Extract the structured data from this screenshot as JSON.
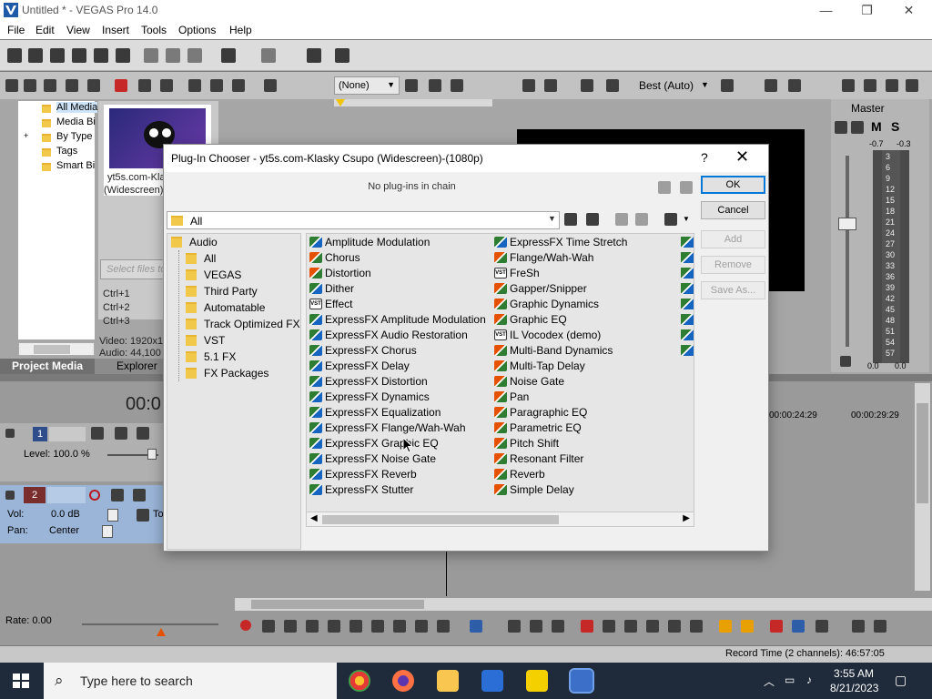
{
  "window": {
    "title": "Untitled * - VEGAS Pro 14.0",
    "minimize": "—",
    "maximize": "❐",
    "close": "✕"
  },
  "menu": [
    "File",
    "Edit",
    "View",
    "Insert",
    "Tools",
    "Options",
    "Help"
  ],
  "explorer": {
    "tree": [
      "All Media",
      "Media Bi",
      "By Type",
      "Tags",
      "Smart Bi"
    ],
    "media_name": "yt5s.com-Kla",
    "media_name2": "(Widescreen)",
    "search_placeholder": "Select files to",
    "shortcuts": [
      "Ctrl+1",
      "Ctrl+2",
      "Ctrl+3"
    ],
    "video_info": "Video: 1920x1",
    "audio_info": "Audio: 44,100",
    "tabs": [
      "Project Media",
      "Explorer"
    ]
  },
  "preview": {
    "preset": "(None)",
    "quality": "Best (Auto)"
  },
  "mixer": {
    "label": "Master",
    "m": "M",
    "s": "S",
    "peak_l": "-0.7",
    "peak_r": "-0.3",
    "scale": [
      "3",
      "6",
      "9",
      "12",
      "15",
      "18",
      "21",
      "24",
      "27",
      "30",
      "33",
      "36",
      "39",
      "42",
      "45",
      "48",
      "51",
      "54",
      "57"
    ],
    "bottom_l": "0.0",
    "bottom_r": "0.0"
  },
  "timeline": {
    "time_display": "00:0",
    "track1": {
      "number": "1",
      "level": "Level: 100.0 %"
    },
    "track2": {
      "number": "2",
      "vol_label": "Vol:",
      "vol_value": "0.0 dB",
      "pan_label": "Pan:",
      "pan_value": "Center",
      "extra": "To"
    },
    "ruler": [
      "00:00:24:29",
      "00:00:29:29"
    ],
    "rate": "Rate: 0.00",
    "record_time": "Record Time (2 channels): 46:57:05"
  },
  "dialog": {
    "title": "Plug-In Chooser - yt5s.com-Klasky Csupo (Widescreen)-(1080p)",
    "help": "?",
    "close": "✕",
    "chain_text": "No plug-ins in chain",
    "path": "All",
    "buttons": {
      "ok": "OK",
      "cancel": "Cancel",
      "add": "Add",
      "remove": "Remove",
      "save_as": "Save As..."
    },
    "folders": [
      {
        "label": "Audio",
        "level": 0
      },
      {
        "label": "All",
        "level": 1
      },
      {
        "label": "VEGAS",
        "level": 1
      },
      {
        "label": "Third Party",
        "level": 1
      },
      {
        "label": "Automatable",
        "level": 1
      },
      {
        "label": "Track Optimized FX",
        "level": 1
      },
      {
        "label": "VST",
        "level": 1
      },
      {
        "label": "5.1 FX",
        "level": 1
      },
      {
        "label": "FX Packages",
        "level": 1
      }
    ],
    "plugins_col1": [
      {
        "name": "Amplitude Modulation",
        "icon": "fx"
      },
      {
        "name": "Chorus",
        "icon": "orange"
      },
      {
        "name": "Distortion",
        "icon": "orange"
      },
      {
        "name": "Dither",
        "icon": "fx"
      },
      {
        "name": "Effect",
        "icon": "vst"
      },
      {
        "name": "ExpressFX Amplitude Modulation",
        "icon": "fx"
      },
      {
        "name": "ExpressFX Audio Restoration",
        "icon": "fx"
      },
      {
        "name": "ExpressFX Chorus",
        "icon": "fx"
      },
      {
        "name": "ExpressFX Delay",
        "icon": "fx"
      },
      {
        "name": "ExpressFX Distortion",
        "icon": "fx"
      },
      {
        "name": "ExpressFX Dynamics",
        "icon": "fx"
      },
      {
        "name": "ExpressFX Equalization",
        "icon": "fx"
      },
      {
        "name": "ExpressFX Flange/Wah-Wah",
        "icon": "fx"
      },
      {
        "name": "ExpressFX Graphic EQ",
        "icon": "fx"
      },
      {
        "name": "ExpressFX Noise Gate",
        "icon": "fx"
      },
      {
        "name": "ExpressFX Reverb",
        "icon": "fx"
      },
      {
        "name": "ExpressFX Stutter",
        "icon": "fx"
      }
    ],
    "plugins_col2": [
      {
        "name": "ExpressFX Time Stretch",
        "icon": "fx"
      },
      {
        "name": "Flange/Wah-Wah",
        "icon": "orange"
      },
      {
        "name": "FreSh",
        "icon": "vst"
      },
      {
        "name": "Gapper/Snipper",
        "icon": "orange"
      },
      {
        "name": "Graphic Dynamics",
        "icon": "orange"
      },
      {
        "name": "Graphic EQ",
        "icon": "orange"
      },
      {
        "name": "IL Vocodex (demo)",
        "icon": "vst"
      },
      {
        "name": "Multi-Band Dynamics",
        "icon": "orange"
      },
      {
        "name": "Multi-Tap Delay",
        "icon": "orange"
      },
      {
        "name": "Noise Gate",
        "icon": "orange"
      },
      {
        "name": "Pan",
        "icon": "orange"
      },
      {
        "name": "Paragraphic EQ",
        "icon": "orange"
      },
      {
        "name": "Parametric EQ",
        "icon": "orange"
      },
      {
        "name": "Pitch Shift",
        "icon": "orange"
      },
      {
        "name": "Resonant Filter",
        "icon": "orange"
      },
      {
        "name": "Reverb",
        "icon": "orange"
      },
      {
        "name": "Simple Delay",
        "icon": "orange"
      }
    ]
  },
  "taskbar": {
    "search_placeholder": "Type here to search",
    "time": "3:55 AM",
    "date": "8/21/2023"
  },
  "colors": {
    "accent": "#0078d7",
    "taskbar": "#1f2a3a",
    "workspace": "#a6a6a6",
    "record_red": "#c62828"
  }
}
